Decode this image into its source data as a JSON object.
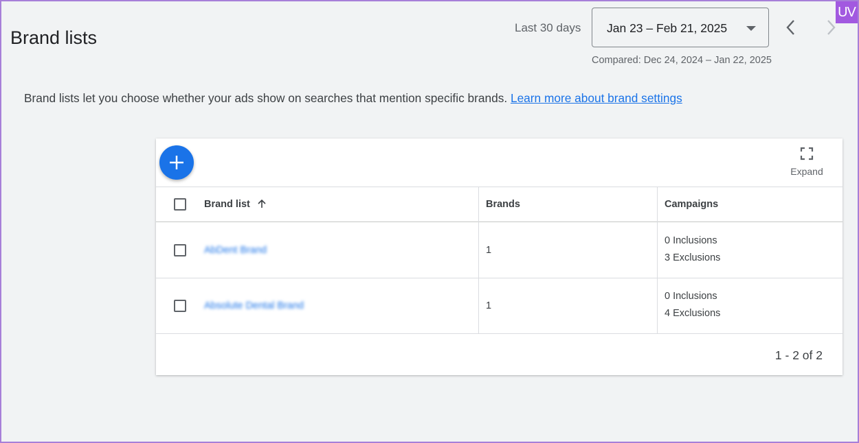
{
  "page": {
    "title": "Brand lists",
    "badge": "UV"
  },
  "date_range": {
    "label": "Last 30 days",
    "value": "Jan 23 – Feb 21, 2025",
    "compared": "Compared: Dec 24, 2024 – Jan 22, 2025"
  },
  "intro": {
    "text": "Brand lists let you choose whether your ads show on searches that mention specific brands. ",
    "link_text": "Learn more about brand settings"
  },
  "toolbar": {
    "expand_label": "Expand"
  },
  "table": {
    "headers": {
      "brand_list": "Brand list",
      "brands": "Brands",
      "campaigns": "Campaigns"
    },
    "rows": [
      {
        "brand_list": "AbDent Brand",
        "brands": "1",
        "inclusions": "0 Inclusions",
        "exclusions": "3 Exclusions"
      },
      {
        "brand_list": "Absolute Dental Brand",
        "brands": "1",
        "inclusions": "0 Inclusions",
        "exclusions": "4 Exclusions"
      }
    ]
  },
  "pagination": {
    "text": "1 - 2 of 2"
  },
  "icons": {
    "add": "add-icon",
    "expand": "fullscreen-icon",
    "sort": "arrow-up-icon",
    "prev": "chevron-left-icon",
    "next": "chevron-right-icon",
    "dropdown": "caret-down-icon"
  },
  "colors": {
    "accent": "#1a73e8",
    "background": "#f1f3f4",
    "badge": "#a259e0"
  }
}
